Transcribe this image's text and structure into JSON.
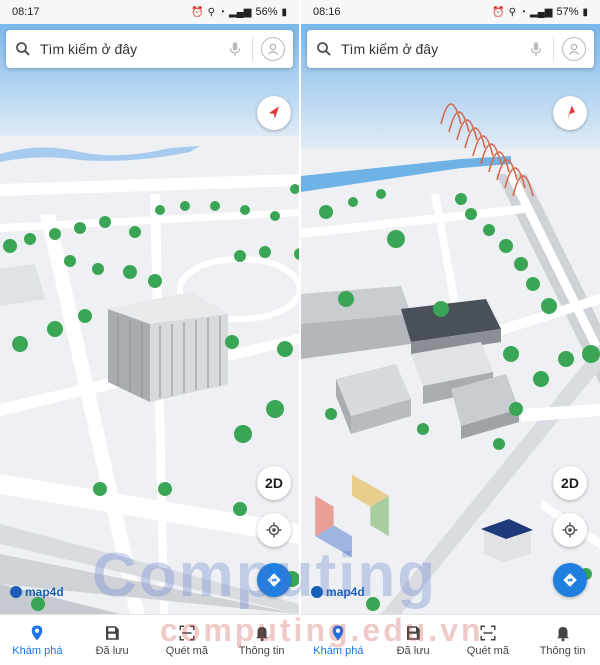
{
  "screens": [
    {
      "status_time": "08:17",
      "battery": "56%",
      "search_placeholder": "Tìm kiếm ở đây",
      "btn_2d": "2D",
      "brand": "map4d",
      "nav": [
        "Khám phá",
        "Đã lưu",
        "Quét mã",
        "Thông tin"
      ]
    },
    {
      "status_time": "08:16",
      "battery": "57%",
      "search_placeholder": "Tìm kiếm ở đây",
      "btn_2d": "2D",
      "brand": "map4d",
      "nav": [
        "Khám phá",
        "Đã lưu",
        "Quét mã",
        "Thông tin"
      ]
    }
  ],
  "watermark": {
    "line1": "Computing",
    "line2": "computing.edu.vn"
  },
  "colors": {
    "accent": "#1a73e8",
    "compass_red": "#e53935",
    "direction_blue": "#1f7fe0",
    "tree_green": "#3aa655",
    "bridge_orange": "#d9674a"
  },
  "icons": {
    "search": "search-icon",
    "mic": "mic-icon",
    "user": "user-icon",
    "compass": "compass-icon",
    "locate": "locate-icon",
    "directions": "directions-icon",
    "explore": "location-pin-icon",
    "saved": "save-icon",
    "scan": "scan-icon",
    "info": "bell-icon"
  }
}
